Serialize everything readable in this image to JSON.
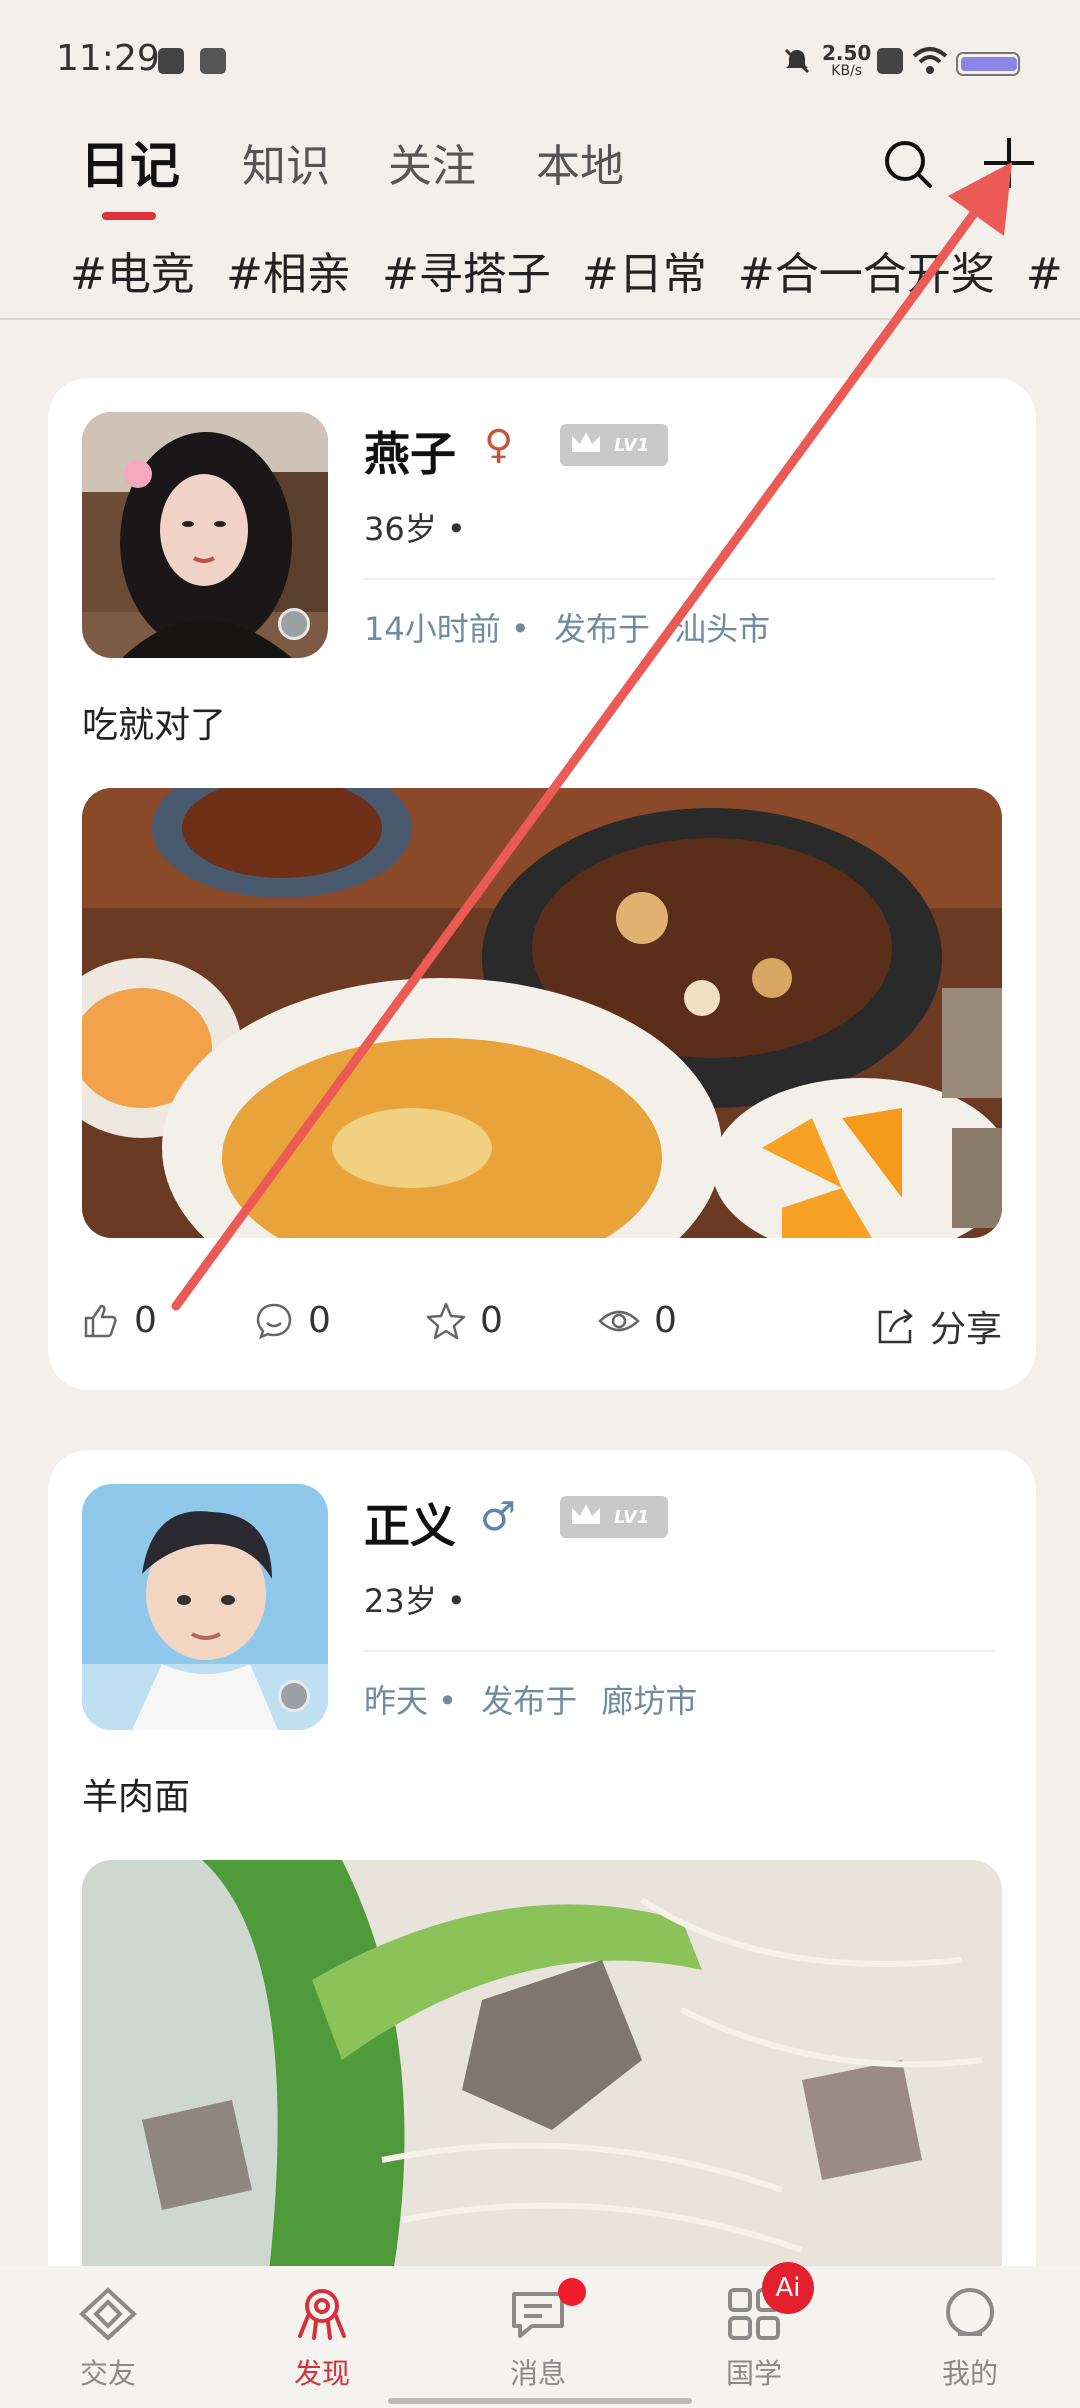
{
  "status_bar": {
    "time": "11:29",
    "net_speed": "2.50",
    "net_unit": "KB/s"
  },
  "tabs": [
    {
      "label": "日记",
      "active": true
    },
    {
      "label": "知识"
    },
    {
      "label": "关注"
    },
    {
      "label": "本地"
    }
  ],
  "hashtags": [
    "#电竞",
    "#相亲",
    "#寻搭子",
    "#日常",
    "#合一合开奖",
    "#"
  ],
  "posts": [
    {
      "name": "燕子",
      "gender_symbol": "♀",
      "level": "LV1",
      "age": "36岁 •",
      "time": "14小时前 •",
      "published_label": "发布于",
      "city": "汕头市",
      "text": "吃就对了",
      "likes": "0",
      "comments": "0",
      "favorites": "0",
      "views": "0",
      "share_label": "分享"
    },
    {
      "name": "正义",
      "gender_symbol": "♂",
      "level": "LV1",
      "age": "23岁 •",
      "time": "昨天 •",
      "published_label": "发布于",
      "city": "廊坊市",
      "text": "羊肉面"
    }
  ],
  "bottom_nav": [
    {
      "label": "交友"
    },
    {
      "label": "发现",
      "active": true
    },
    {
      "label": "消息",
      "has_dot": true
    },
    {
      "label": "国学",
      "badge": "Ai"
    },
    {
      "label": "我的"
    }
  ],
  "colors": {
    "accent": "#d6303a",
    "annotation_arrow": "#ec5a55",
    "meta_text": "#6f8b9e"
  }
}
